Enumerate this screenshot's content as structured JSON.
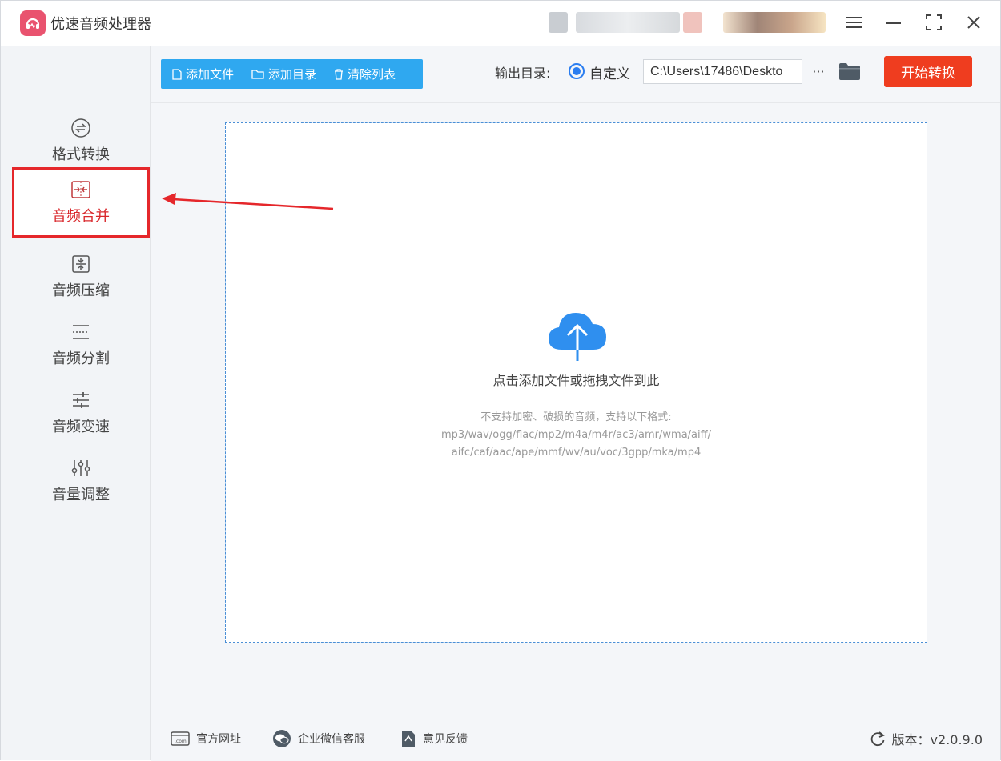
{
  "app": {
    "title": "优速音频处理器"
  },
  "colors": {
    "accent_blue": "#2fa8f0",
    "start_button": "#ef3d1f",
    "active_border": "#e5272b",
    "logo": "#e9536f"
  },
  "sidebar": {
    "items": [
      {
        "label": "格式转换",
        "icon": "format-convert-icon"
      },
      {
        "label": "音频合并",
        "icon": "merge-icon",
        "active": true
      },
      {
        "label": "音频压缩",
        "icon": "compress-icon"
      },
      {
        "label": "音频分割",
        "icon": "split-icon"
      },
      {
        "label": "音频变速",
        "icon": "speed-icon"
      },
      {
        "label": "音量调整",
        "icon": "volume-adjust-icon"
      }
    ]
  },
  "toolbar": {
    "add_file": "添加文件",
    "add_folder": "添加目录",
    "clear_list": "清除列表"
  },
  "output": {
    "label": "输出目录:",
    "option": "自定义",
    "path": "C:\\Users\\17486\\Deskto",
    "more": "···",
    "start": "开始转换"
  },
  "dropzone": {
    "title": "点击添加文件或拖拽文件到此",
    "hint_line1": "不支持加密、破损的音频，支持以下格式:",
    "hint_line2": "mp3/wav/ogg/flac/mp2/m4a/m4r/ac3/amr/wma/aiff/",
    "hint_line3": "aifc/caf/aac/ape/mmf/wv/au/voc/3gpp/mka/mp4"
  },
  "footer": {
    "website": "官方网址",
    "wechat": "企业微信客服",
    "feedback": "意见反馈",
    "version": "版本：v2.0.9.0"
  }
}
